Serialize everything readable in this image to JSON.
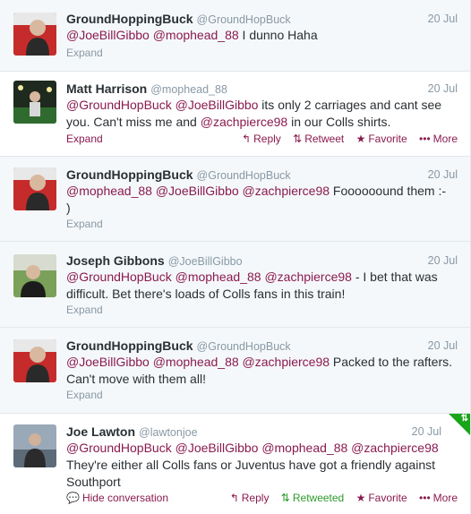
{
  "tweets": [
    {
      "name": "GroundHoppingBuck",
      "handle": "@GroundHopBuck",
      "time": "20 Jul",
      "text_line1": [
        {
          "m": "@JoeBillGibbo"
        },
        {
          "t": " "
        },
        {
          "m": "@mophead_88"
        },
        {
          "t": " I dunno Haha"
        }
      ],
      "expand": "Expand"
    },
    {
      "name": "Matt Harrison",
      "handle": "@mophead_88",
      "time": "20 Jul",
      "text_line1": [
        {
          "m": "@GroundHopBuck"
        },
        {
          "t": " "
        },
        {
          "m": "@JoeBillGibbo"
        },
        {
          "t": " its only 2 carriages and cant see"
        }
      ],
      "text_line2": [
        {
          "t": "you. Can't miss me and "
        },
        {
          "m": "@zachpierce98"
        },
        {
          "t": " in our Colls shirts."
        }
      ],
      "expand": "Expand",
      "reply": "Reply",
      "retweet": "Retweet",
      "favorite": "Favorite",
      "more": "More"
    },
    {
      "name": "GroundHoppingBuck",
      "handle": "@GroundHopBuck",
      "time": "20 Jul",
      "text_line1": [
        {
          "m": "@mophead_88"
        },
        {
          "t": " "
        },
        {
          "m": "@JoeBillGibbo"
        },
        {
          "t": " "
        },
        {
          "m": "@zachpierce98"
        },
        {
          "t": " Foooooound them :-"
        }
      ],
      "text_line2": [
        {
          "t": ")"
        }
      ],
      "expand": "Expand"
    },
    {
      "name": "Joseph Gibbons",
      "handle": "@JoeBillGibbo",
      "time": "20 Jul",
      "text_line1": [
        {
          "m": "@GroundHopBuck"
        },
        {
          "t": " "
        },
        {
          "m": "@mophead_88"
        },
        {
          "t": " "
        },
        {
          "m": "@zachpierce98"
        },
        {
          "t": " - I bet that was"
        }
      ],
      "text_line2": [
        {
          "t": "difficult. Bet there's loads of Colls fans in this train!"
        }
      ],
      "expand": "Expand"
    },
    {
      "name": "GroundHoppingBuck",
      "handle": "@GroundHopBuck",
      "time": "20 Jul",
      "text_line1": [
        {
          "m": "@JoeBillGibbo"
        },
        {
          "t": " "
        },
        {
          "m": "@mophead_88"
        },
        {
          "t": " "
        },
        {
          "m": "@zachpierce98"
        },
        {
          "t": " Packed to the rafters."
        }
      ],
      "text_line2": [
        {
          "t": "Can't move with them all!"
        }
      ],
      "expand": "Expand"
    },
    {
      "name": "Joe Lawton",
      "handle": "@lawtonjoe",
      "time": "20 Jul",
      "text_line1": [
        {
          "m": "@GroundHopBuck"
        },
        {
          "t": " "
        },
        {
          "m": "@JoeBillGibbo"
        },
        {
          "t": " "
        },
        {
          "m": "@mophead_88"
        },
        {
          "t": " "
        },
        {
          "m": "@zachpierce98"
        }
      ],
      "text_line2": [
        {
          "t": "They're either all Colls fans or Juventus have got a friendly against"
        }
      ],
      "text_line3": [
        {
          "t": "Southport"
        }
      ],
      "hide": "Hide conversation",
      "reply": "Reply",
      "retweet": "Retweeted",
      "favorite": "Favorite",
      "more": "More"
    }
  ],
  "colors": {
    "mention": "#8a1a4f",
    "retweeted": "#2d9b2d",
    "muted": "#8899a6"
  }
}
